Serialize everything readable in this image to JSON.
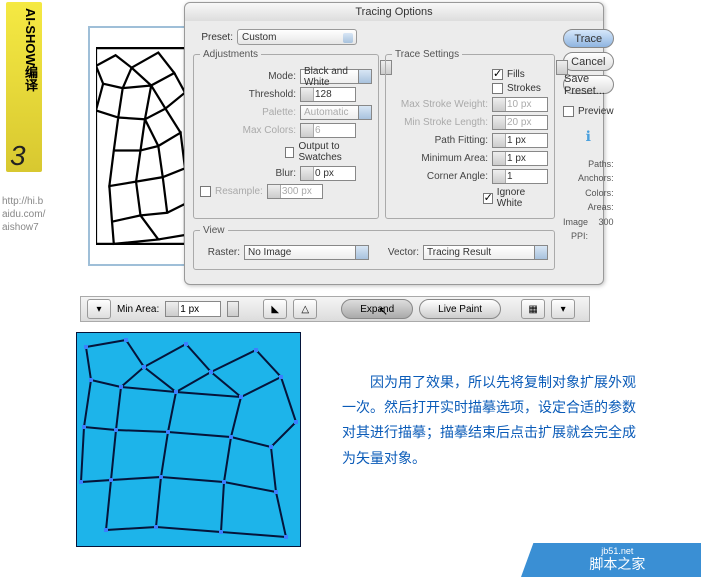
{
  "badge": {
    "text": "AI-SHOW编译",
    "num": "3"
  },
  "url": "http://hi.b\naidu.com/\naishow7",
  "dialog": {
    "title": "Tracing Options",
    "preset_label": "Preset:",
    "preset_value": "Custom",
    "adjustments": {
      "legend": "Adjustments",
      "mode_label": "Mode:",
      "mode_value": "Black and White",
      "threshold_label": "Threshold:",
      "threshold_value": "128",
      "palette_label": "Palette:",
      "palette_value": "Automatic",
      "maxcolors_label": "Max Colors:",
      "maxcolors_value": "6",
      "output_swatches": "Output to Swatches",
      "blur_label": "Blur:",
      "blur_value": "0 px",
      "resample_label": "Resample:",
      "resample_value": "300 px"
    },
    "trace_settings": {
      "legend": "Trace Settings",
      "fills": "Fills",
      "strokes": "Strokes",
      "max_stroke_w_label": "Max Stroke Weight:",
      "max_stroke_w_value": "10 px",
      "min_stroke_l_label": "Min Stroke Length:",
      "min_stroke_l_value": "20 px",
      "path_fitting_label": "Path Fitting:",
      "path_fitting_value": "1 px",
      "min_area_label": "Minimum Area:",
      "min_area_value": "1 px",
      "corner_angle_label": "Corner Angle:",
      "corner_angle_value": "1",
      "ignore_white": "Ignore White"
    },
    "view": {
      "legend": "View",
      "raster_label": "Raster:",
      "raster_value": "No Image",
      "vector_label": "Vector:",
      "vector_value": "Tracing Result"
    },
    "buttons": {
      "trace": "Trace",
      "cancel": "Cancel",
      "save": "Save Preset..."
    },
    "preview_label": "Preview",
    "info": {
      "paths_label": "Paths:",
      "anchors_label": "Anchors:",
      "colors_label": "Colors:",
      "areas_label": "Areas:",
      "ppi_label": "Image PPI:",
      "ppi_value": "300"
    }
  },
  "toolbar": {
    "min_area_label": "Min Area:",
    "min_area_value": "1 px",
    "expand": "Expand",
    "live_paint": "Live Paint"
  },
  "explain": "　　因为用了效果，所以先将复制对象扩展外观一次。然后打开实时描摹选项，设定合适的参数对其进行描摹；描摹结束后点击扩展就会完全成为矢量对象。",
  "footer": {
    "site": "jb51.net",
    "name": "脚本之家"
  }
}
